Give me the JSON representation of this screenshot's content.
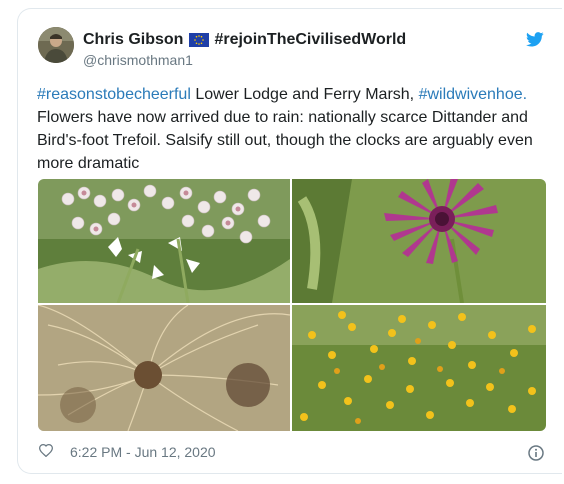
{
  "author": {
    "name": "Chris Gibson",
    "flag_icon": "eu-flag-icon",
    "display_suffix": "#rejoinTheCivilisedWorld",
    "handle": "@chrismothman1"
  },
  "tweet": {
    "hashtag1": "#reasonstobecheerful",
    "text_after_hashtag1": " Lower Lodge and Ferry Marsh, ",
    "hashtag2": "#wildwivenhoe.",
    "text_rest": " Flowers have now arrived due to rain: nationally scarce Dittander and Bird's-foot Trefoil. Salsify still out, though the clocks are arguably even more dramatic"
  },
  "photos": [
    {
      "subject": "dittander-flowers-photo"
    },
    {
      "subject": "salsify-flower-photo"
    },
    {
      "subject": "salsify-seedhead-clock-photo"
    },
    {
      "subject": "birds-foot-trefoil-photo"
    }
  ],
  "footer": {
    "timestamp": "6:22 PM - Jun 12, 2020",
    "like_icon": "heart-icon",
    "info_icon": "info-icon"
  },
  "colors": {
    "link": "#2b7bb9",
    "twitter_blue": "#1da1f2",
    "muted": "#697882",
    "border": "#e1e8ed"
  }
}
